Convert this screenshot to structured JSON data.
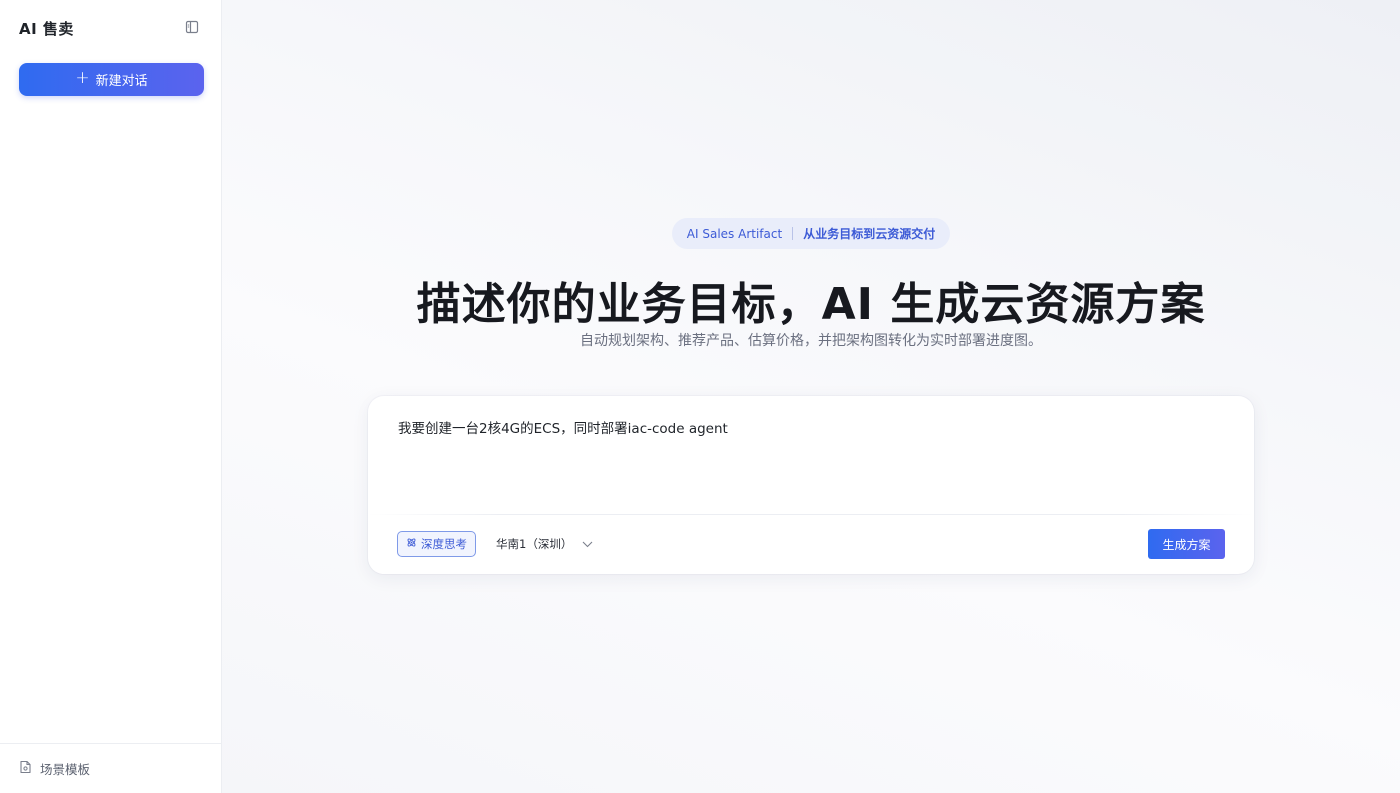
{
  "sidebar": {
    "brand": "AI 售卖",
    "new_chat_label": "新建对话",
    "footer_label": "场景模板"
  },
  "hero": {
    "pill_en": "AI Sales Artifact",
    "pill_cn": "从业务目标到云资源交付",
    "title": "描述你的业务目标，AI 生成云资源方案",
    "subtitle": "自动规划架构、推荐产品、估算价格，并把架构图转化为实时部署进度图。"
  },
  "composer": {
    "prompt_value": "我要创建一台2核4G的ECS，同时部署iac-code agent",
    "deep_think_label": "深度思考",
    "region_label": "华南1（深圳）",
    "generate_label": "生成方案"
  },
  "colors": {
    "accent": "#2f6bf0",
    "accent_end": "#5b63ee",
    "pill_bg": "#e9edfa"
  },
  "icons": [
    "collapse-sidebar-icon",
    "plus-icon",
    "template-file-icon",
    "deep-think-icon",
    "chevron-down-icon"
  ]
}
